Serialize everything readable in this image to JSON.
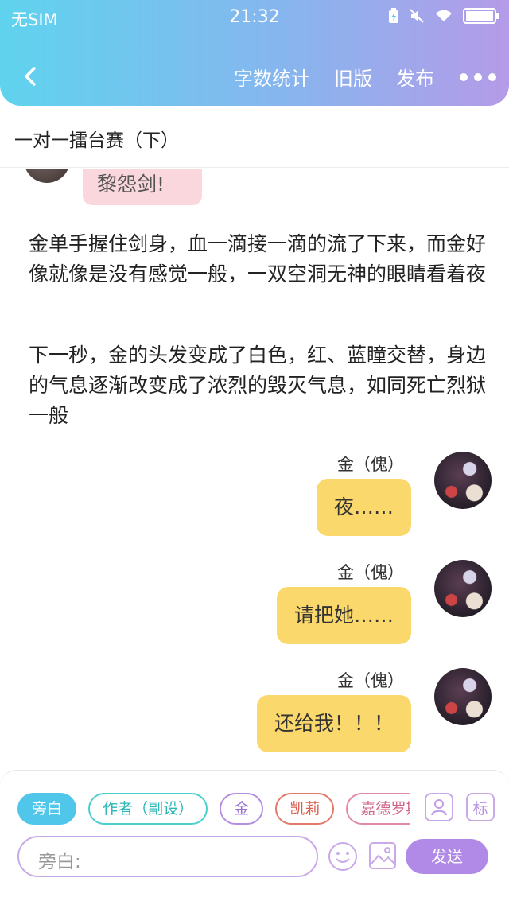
{
  "status_bar": {
    "carrier": "无SIM",
    "time": "21:32"
  },
  "nav": {
    "word_count": "字数统计",
    "old_version": "旧版",
    "publish": "发布"
  },
  "chapter_title": "一对一擂台赛（下）",
  "partial_bubble": "黎怨剑!",
  "narration": [
    "金单手握住剑身，血一滴接一滴的流了下来，而金好像就像是没有感觉一般，一双空洞无神的眼睛看着夜",
    "下一秒，金的头发变成了白色，红、蓝瞳交替，身边的气息逐渐改变成了浓烈的毁灭气息，如同死亡烈狱一般"
  ],
  "messages": [
    {
      "speaker": "金（傀）",
      "text": "夜……"
    },
    {
      "speaker": "金（傀）",
      "text": "请把她……"
    },
    {
      "speaker": "金（傀）",
      "text": "还给我！！！"
    }
  ],
  "roles": [
    "旁白",
    "作者（副设）",
    "金",
    "凯莉",
    "嘉德罗斯"
  ],
  "tools": {
    "biao": "标"
  },
  "input": {
    "placeholder": "旁白:"
  },
  "send_label": "发送",
  "colors": {
    "accent": "#b08ae6",
    "bubble_self": "#fbd86b",
    "bubble_other": "#f9d7dc"
  }
}
